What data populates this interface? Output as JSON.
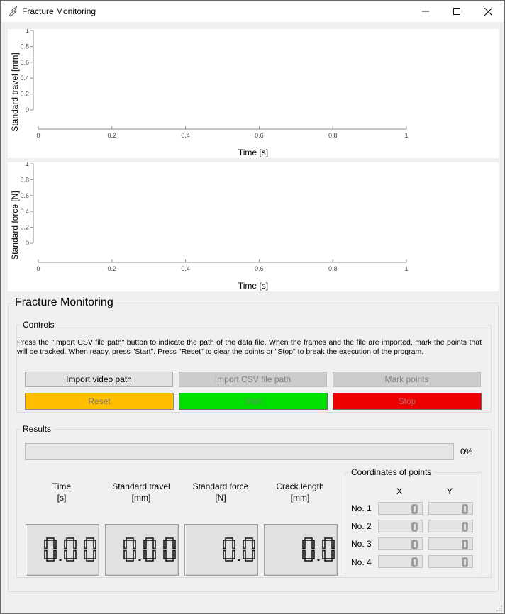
{
  "window": {
    "title": "Fracture Monitoring",
    "controls": [
      "minimize-icon",
      "maximize-icon",
      "close-icon"
    ]
  },
  "chart_data": [
    {
      "type": "line",
      "title": "",
      "xlabel": "Time [s]",
      "ylabel": "Standard travel [mm]",
      "xlim": [
        0,
        1
      ],
      "ylim": [
        0,
        1
      ],
      "x_ticks": [
        "0",
        "0.2",
        "0.4",
        "0.6",
        "0.8",
        "1"
      ],
      "y_ticks": [
        "0",
        "0.2",
        "0.4",
        "0.6",
        "0.8",
        "1"
      ],
      "series": [],
      "grid": false
    },
    {
      "type": "line",
      "title": "",
      "xlabel": "Time [s]",
      "ylabel": "Standard force [N]",
      "xlim": [
        0,
        1
      ],
      "ylim": [
        0,
        1
      ],
      "x_ticks": [
        "0",
        "0.2",
        "0.4",
        "0.6",
        "0.8",
        "1"
      ],
      "y_ticks": [
        "0",
        "0.2",
        "0.4",
        "0.6",
        "0.8",
        "1"
      ],
      "series": [],
      "grid": false
    }
  ],
  "panel": {
    "title": "Fracture Monitoring",
    "controls": {
      "title": "Controls",
      "instructions": "Press the \"Import CSV file path\" button to indicate the path of the data file. When the frames and the file are imported, mark the points that will be tracked. When ready, press \"Start\". Press \"Reset\" to clear the points or \"Stop\" to break the execution of the program.",
      "buttons": {
        "import_video": "Import video path",
        "import_csv": "Import CSV file path",
        "mark_points": "Mark points",
        "reset": "Reset",
        "start": "Start",
        "stop": "Stop"
      },
      "colors": {
        "reset": "#ffbf00",
        "start": "#00e000",
        "stop": "#ee0000"
      }
    },
    "results": {
      "title": "Results",
      "progress": 0,
      "progress_text": "0%",
      "readouts": [
        {
          "label": "Time",
          "unit": "[s]",
          "value": "0.00"
        },
        {
          "label": "Standard travel",
          "unit": "[mm]",
          "value": "0.00"
        },
        {
          "label": "Standard force",
          "unit": "[N]",
          "value": "0.0"
        },
        {
          "label": "Crack length",
          "unit": "[mm]",
          "value": "0.0"
        }
      ],
      "coordinates": {
        "title": "Coordinates of points",
        "x_header": "X",
        "y_header": "Y",
        "rows": [
          {
            "label": "No. 1",
            "x": "0",
            "y": "0"
          },
          {
            "label": "No. 2",
            "x": "0",
            "y": "0"
          },
          {
            "label": "No. 3",
            "x": "0",
            "y": "0"
          },
          {
            "label": "No. 4",
            "x": "0",
            "y": "0"
          }
        ]
      }
    }
  }
}
